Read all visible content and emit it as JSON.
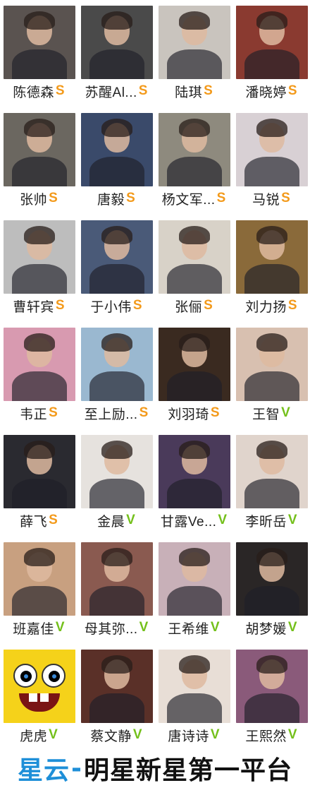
{
  "grid": {
    "rows": [
      [
        {
          "name": "陈德森",
          "badge": "S",
          "bg": "#5a5350"
        },
        {
          "name": "苏醒Al...",
          "badge": "S",
          "bg": "#4a4a4a"
        },
        {
          "name": "陆琪",
          "badge": "S",
          "bg": "#c9c4be"
        },
        {
          "name": "潘晓婷",
          "badge": "S",
          "bg": "#8a3a30"
        }
      ],
      [
        {
          "name": "张帅",
          "badge": "S",
          "bg": "#6b6760"
        },
        {
          "name": "唐毅",
          "badge": "S",
          "bg": "#3a4a6a"
        },
        {
          "name": "杨文军...",
          "badge": "S",
          "bg": "#8e8a7e"
        },
        {
          "name": "马锐",
          "badge": "S",
          "bg": "#d8d0d4"
        }
      ],
      [
        {
          "name": "曹轩宾",
          "badge": "S",
          "bg": "#bdbdbd"
        },
        {
          "name": "于小伟",
          "badge": "S",
          "bg": "#4a5a78"
        },
        {
          "name": "张俪",
          "badge": "S",
          "bg": "#d8d2c8"
        },
        {
          "name": "刘力扬",
          "badge": "S",
          "bg": "#8a6a3a"
        }
      ],
      [
        {
          "name": "韦正",
          "badge": "S",
          "bg": "#d89ab0"
        },
        {
          "name": "至上励...",
          "badge": "S",
          "bg": "#9ab8d0"
        },
        {
          "name": "刘羽琦",
          "badge": "S",
          "bg": "#3a2a20"
        },
        {
          "name": "王智",
          "badge": "V",
          "bg": "#d8c0b0"
        }
      ],
      [
        {
          "name": "薛飞",
          "badge": "S",
          "bg": "#2a2a30"
        },
        {
          "name": "金晨",
          "badge": "V",
          "bg": "#e6e2de"
        },
        {
          "name": "甘露Ve...",
          "badge": "V",
          "bg": "#4a3a5a"
        },
        {
          "name": "李昕岳",
          "badge": "V",
          "bg": "#e0d4cc"
        }
      ],
      [
        {
          "name": "班嘉佳",
          "badge": "V",
          "bg": "#c8a080"
        },
        {
          "name": "母其弥...",
          "badge": "V",
          "bg": "#8a5a50"
        },
        {
          "name": "王希维",
          "badge": "V",
          "bg": "#c8b0b8"
        },
        {
          "name": "胡梦媛",
          "badge": "V",
          "bg": "#2a2626"
        }
      ],
      [
        {
          "name": "虎虎",
          "badge": "V",
          "bg": "#f5d21a",
          "icon": "sponge-face"
        },
        {
          "name": "蔡文静",
          "badge": "V",
          "bg": "#5a3028"
        },
        {
          "name": "唐诗诗",
          "badge": "V",
          "bg": "#e8ded6"
        },
        {
          "name": "王熙然",
          "badge": "V",
          "bg": "#8a5a7a"
        }
      ]
    ]
  },
  "badge_colors": {
    "S": "#f39a1b",
    "V": "#74c01b"
  },
  "footer": {
    "brand": "星云",
    "dash": "-",
    "slogan": "明星新星第一平台"
  }
}
